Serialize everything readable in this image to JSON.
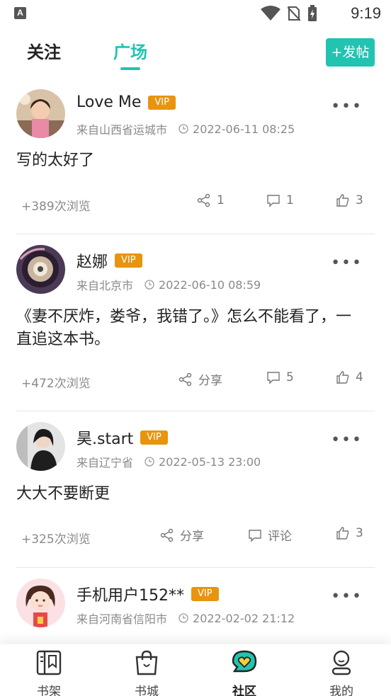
{
  "status_bar": {
    "time": "9:19",
    "app_letter": "A"
  },
  "header": {
    "tabs": [
      {
        "label": "关注",
        "active": false
      },
      {
        "label": "广场",
        "active": true
      }
    ],
    "post_button": "+发帖",
    "accent_color": "#22c3b0"
  },
  "posts": [
    {
      "username": "Love Me",
      "vip": "VIP",
      "location": "来自山西省运城市",
      "time": "2022-06-11 08:25",
      "content": "写的太好了",
      "views": "+389次浏览",
      "share": "1",
      "comments": "1",
      "likes": "3"
    },
    {
      "username": "赵娜",
      "vip": "VIP",
      "location": "来自北京市",
      "time": "2022-06-10 08:59",
      "content": "《妻不厌炸，娄爷，我错了。》怎么不能看了，一直追这本书。",
      "views": "+472次浏览",
      "share": "分享",
      "comments": "5",
      "likes": "4"
    },
    {
      "username": "昊.start",
      "vip": "VIP",
      "location": "来自辽宁省",
      "time": "2022-05-13 23:00",
      "content": "大大不要断更",
      "views": "+325次浏览",
      "share": "分享",
      "comments": "评论",
      "likes": "3"
    },
    {
      "username": "手机用户152**",
      "vip": "VIP",
      "location": "来自河南省信阳市",
      "time": "2022-02-02 21:12",
      "content": "",
      "views": "",
      "share": "",
      "comments": "",
      "likes": ""
    }
  ],
  "bottom_nav": [
    {
      "label": "书架",
      "icon": "bookshelf-icon",
      "active": false
    },
    {
      "label": "书城",
      "icon": "bookstore-bag-icon",
      "active": false
    },
    {
      "label": "社区",
      "icon": "community-heart-icon",
      "active": true
    },
    {
      "label": "我的",
      "icon": "profile-icon",
      "active": false
    }
  ]
}
